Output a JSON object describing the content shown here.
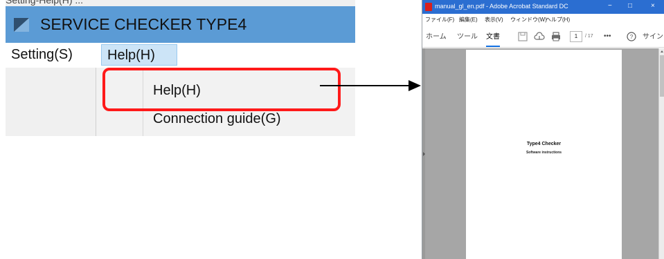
{
  "clipped_caption": "Setting-Help(H)  ...",
  "app": {
    "title": "SERVICE CHECKER TYPE4",
    "logo_icon": "app-logo-icon",
    "menu": {
      "setting_label": "Setting(S)",
      "help_label": "Help(H)"
    },
    "dropdown": {
      "items": [
        {
          "label": "Help(H)"
        },
        {
          "label": "Connection guide(G)"
        }
      ]
    },
    "highlight_color": "#ff1a1a"
  },
  "acrobat": {
    "window_title": "manual_gl_en.pdf - Adobe Acrobat Standard DC",
    "window_buttons": {
      "minimize": "−",
      "maximize": "□",
      "close": "×"
    },
    "menus": [
      "ファイル(F)",
      "編集(E)",
      "表示(V)",
      "ウィンドウ(W)",
      "ヘルプ(H)"
    ],
    "tabs": {
      "home": "ホーム",
      "tools": "ツール",
      "document": "文書"
    },
    "page_current": "1",
    "page_total": "/ 17",
    "more": "•••",
    "help_icon": "?",
    "sign_in": "サインイン",
    "document": {
      "heading": "Type4 Checker",
      "subheading": "Software instructions"
    },
    "accent_color": "#2b6ed1"
  }
}
